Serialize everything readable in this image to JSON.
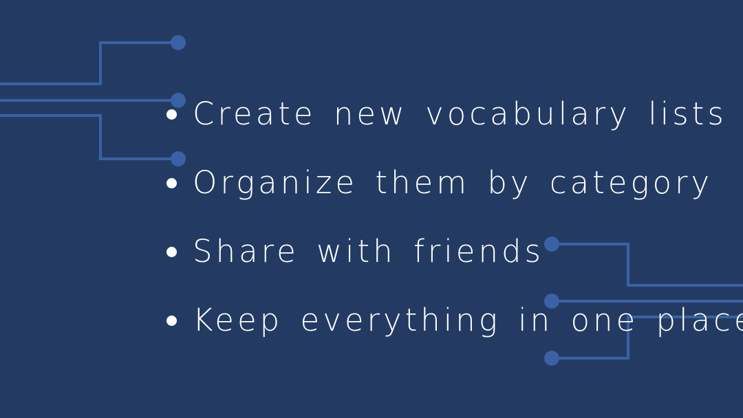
{
  "bullets": [
    "Create new vocabulary lists",
    "Organize them by category",
    "Share with friends",
    "Keep everything in one place"
  ],
  "colors": {
    "background": "#233b63",
    "circuit": "#3a61a3",
    "text": "#ffffff"
  }
}
